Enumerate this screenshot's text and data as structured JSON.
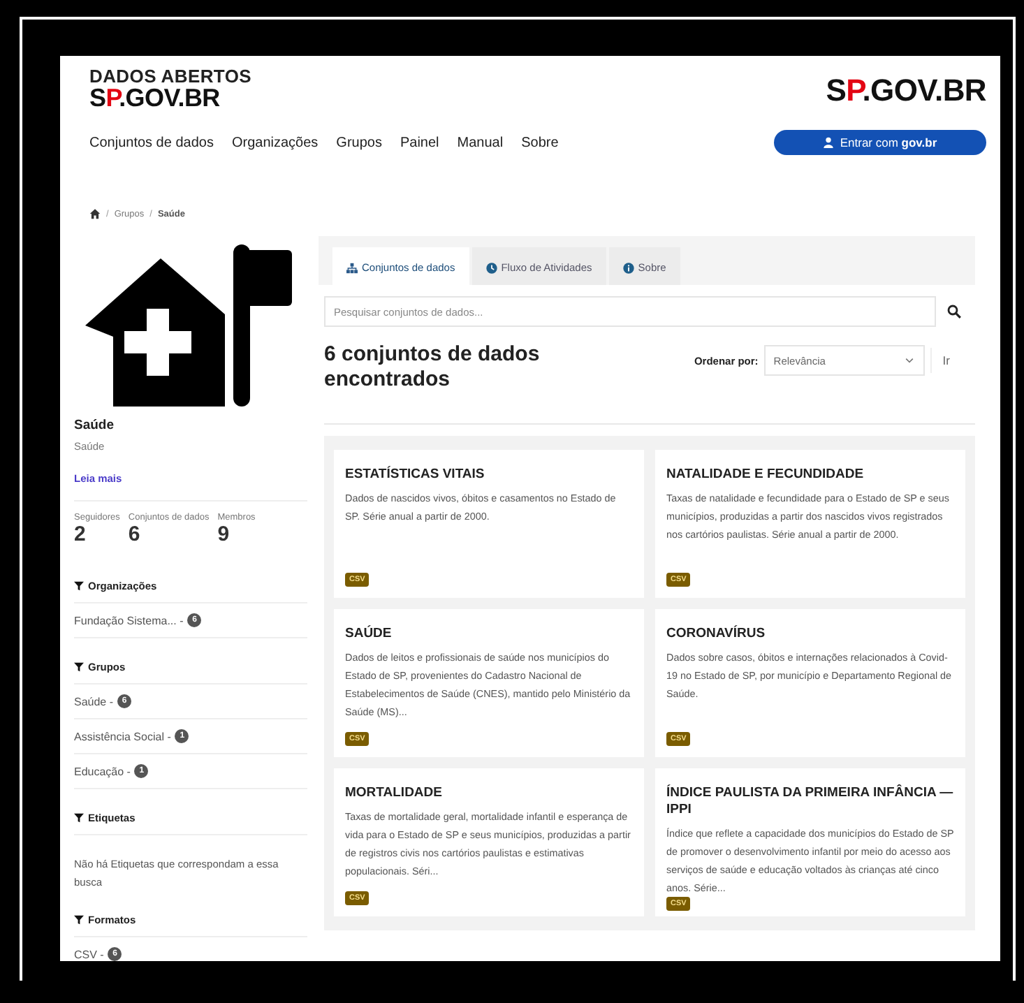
{
  "header": {
    "site_title": "DADOS ABERTOS",
    "logo_parts": [
      {
        "text": "S",
        "color": "#111111"
      },
      {
        "text": "P",
        "color": "#e30613"
      },
      {
        "text": ".GOV.BR",
        "color": "#111111"
      }
    ],
    "right_logo_parts": [
      {
        "text": "S",
        "color": "#111111"
      },
      {
        "text": "P",
        "color": "#e30613"
      },
      {
        "text": ".GOV.BR",
        "color": "#111111"
      }
    ]
  },
  "nav": [
    "Conjuntos de dados",
    "Organizações",
    "Grupos",
    "Painel",
    "Manual",
    "Sobre"
  ],
  "login_button": {
    "text": "Entrar com ",
    "bold": "gov.br"
  },
  "breadcrumb": [
    {
      "separator": "/",
      "label": "Grupos"
    },
    {
      "separator": "/",
      "label": "Saúde"
    }
  ],
  "group": {
    "name": "Saúde",
    "description": "Saúde",
    "read_more": "Leia mais",
    "stats": [
      {
        "label": "Seguidores",
        "value": "2"
      },
      {
        "label": "Conjuntos de dados",
        "value": "6"
      },
      {
        "label": "Membros",
        "value": "9"
      }
    ]
  },
  "facets": [
    {
      "title": "Organizações",
      "items": [
        {
          "label": "Fundação Sistema... -",
          "count": "6"
        }
      ]
    },
    {
      "title": "Grupos",
      "items": [
        {
          "label": "Saúde -",
          "count": "6"
        },
        {
          "label": "Assistência Social -",
          "count": "1"
        },
        {
          "label": "Educação -",
          "count": "1"
        }
      ]
    },
    {
      "title": "Etiquetas",
      "empty_text": "Não há Etiquetas que correspondam a essa busca"
    },
    {
      "title": "Formatos",
      "items": [
        {
          "label": "CSV -",
          "count": "6"
        }
      ]
    }
  ],
  "tabs": [
    {
      "label": "Conjuntos de dados",
      "kind": "datasets",
      "selected": true
    },
    {
      "label": "Fluxo de Atividades",
      "kind": "activity",
      "selected": false
    },
    {
      "label": "Sobre",
      "kind": "about",
      "selected": false
    }
  ],
  "search": {
    "placeholder": "Pesquisar conjuntos de dados..."
  },
  "results_heading": "6 conjuntos de dados encontrados",
  "sort": {
    "label": "Ordenar por:",
    "value": "Relevância",
    "go": "Ir"
  },
  "datasets": [
    {
      "title": "ESTATÍSTICAS VITAIS",
      "description": "Dados de nascidos vivos, óbitos e casamentos no Estado de SP. Série anual a partir de 2000.",
      "formats": [
        "CSV"
      ]
    },
    {
      "title": "NATALIDADE E FECUNDIDADE",
      "description": "Taxas de natalidade e fecundidade para o Estado de SP e seus municípios, produzidas a partir dos nascidos vivos registrados nos cartórios paulistas. Série anual a partir de 2000.",
      "formats": [
        "CSV"
      ]
    },
    {
      "title": "SAÚDE",
      "description": "Dados de leitos e profissionais de saúde nos municípios do Estado de SP, provenientes do Cadastro Nacional de Estabelecimentos de Saúde (CNES), mantido pelo Ministério da Saúde (MS)...",
      "formats": [
        "CSV"
      ]
    },
    {
      "title": "CORONAVÍRUS",
      "description": "Dados sobre casos, óbitos e internações relacionados à Covid-19 no Estado de SP, por município e Departamento Regional de Saúde.",
      "formats": [
        "CSV"
      ]
    },
    {
      "title": "MORTALIDADE",
      "description": "Taxas de mortalidade geral, mortalidade infantil e esperança de vida para o Estado de SP e seus municípios, produzidas a partir de registros civis nos cartórios paulistas e estimativas populacionais. Séri...",
      "formats": [
        "CSV"
      ]
    },
    {
      "title": "ÍNDICE PAULISTA DA PRIMEIRA INFÂNCIA — IPPI",
      "description": "Índice que reflete a capacidade dos municípios do Estado de SP de promover o desenvolvimento infantil por meio do acesso aos serviços de saúde e educação voltados às crianças até cinco anos. Série...",
      "formats": [
        "CSV"
      ]
    }
  ]
}
